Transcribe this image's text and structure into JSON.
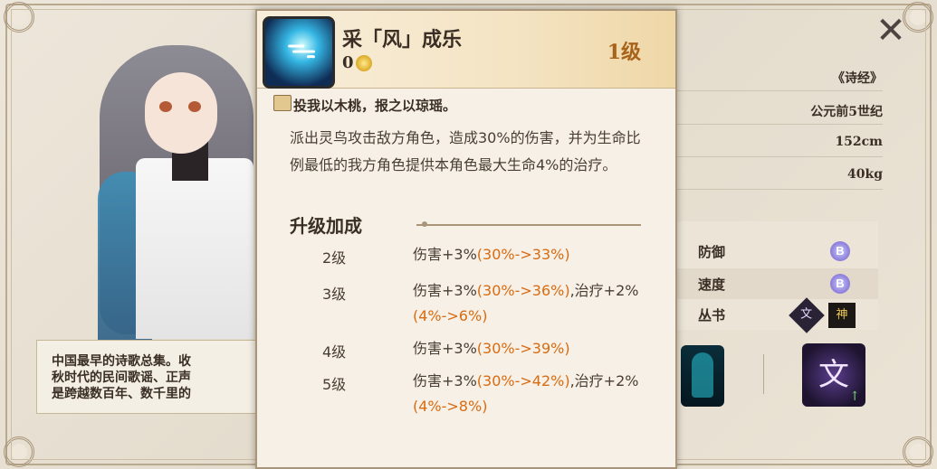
{
  "popup": {
    "skill_name": "采「风」成乐",
    "cost": "0",
    "level": "1级",
    "quote": "投我以木桃，报之以琼瑶。",
    "effect": "派出灵鸟攻击敌方角色，造成30%的伤害，并为生命比例最低的我方角色提供本角色最大生命4%的治疗。",
    "upgrade_title": "升级加成",
    "upgrades": [
      {
        "level": "2级",
        "prefix": "伤害+3%",
        "hl1": "(30%->33%)",
        "mid": "",
        "hl2": ""
      },
      {
        "level": "3级",
        "prefix": "伤害+3%",
        "hl1": "(30%->36%)",
        "mid": ",治疗+2%",
        "hl2": "(4%->6%)"
      },
      {
        "level": "4级",
        "prefix": "伤害+3%",
        "hl1": "(30%->39%)",
        "mid": "",
        "hl2": ""
      },
      {
        "level": "5级",
        "prefix": "伤害+3%",
        "hl1": "(30%->42%)",
        "mid": ",治疗+2%",
        "hl2": "(4%->8%)"
      }
    ]
  },
  "info": {
    "source": "《诗经》",
    "era": "公元前5世纪",
    "height": "152cm",
    "weight": "40kg"
  },
  "stats": [
    {
      "label": "防御",
      "grade": "B"
    },
    {
      "label": "速度",
      "grade": "B"
    },
    {
      "label": "丛书",
      "badge1": "文",
      "badge2": "神"
    }
  ],
  "skill_icon_b": {
    "glyph": "文",
    "up_arrow": "↑"
  },
  "description": {
    "line1": "中国最早的诗歌总集。收",
    "line2": "秋时代的民间歌谣、正声",
    "line3": "是跨越数百年、数千里的"
  },
  "close_glyph": "✕",
  "colors": {
    "highlight": "#d96b10",
    "level": "#a8631a",
    "text": "#3b2f25"
  }
}
